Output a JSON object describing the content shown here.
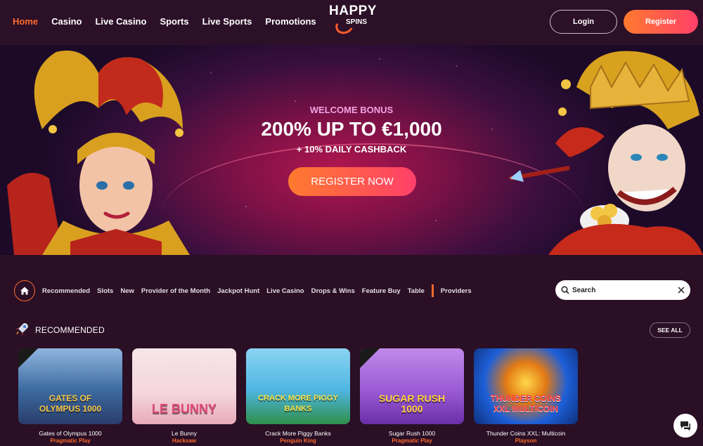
{
  "header": {
    "nav": [
      "Home",
      "Casino",
      "Live Casino",
      "Sports",
      "Live Sports",
      "Promotions"
    ],
    "logo_line1": "HAPPY",
    "logo_line2": "SPINS",
    "login": "Login",
    "register": "Register"
  },
  "hero": {
    "welcome": "WELCOME BONUS",
    "headline": "200% UP TO €1,000",
    "cashback": "+ 10% DAILY CASHBACK",
    "cta": "REGISTER NOW"
  },
  "categories": [
    "Recommended",
    "Slots",
    "New",
    "Provider of the Month",
    "Jackpot Hunt",
    "Live Casino",
    "Drops & Wins",
    "Feature Buy",
    "Table"
  ],
  "providers_label": "Providers",
  "search": {
    "placeholder": "Search"
  },
  "recommended": {
    "title": "RECOMMENDED",
    "see_all": "SEE ALL",
    "games": [
      {
        "name": "Gates of Olympus 1000",
        "provider": "Pragmatic Play",
        "art": "GATES OF OLYMPUS 1000",
        "badge": "DROPS & WINS",
        "bg": "#3c6aa0",
        "fg": "#f5c542"
      },
      {
        "name": "Le Bunny",
        "provider": "Hacksaw",
        "art": "LE BUNNY",
        "badge": "",
        "bg": "#f4d6dc",
        "fg": "#e14a7c"
      },
      {
        "name": "Crack More Piggy Banks",
        "provider": "Penguin King",
        "art": "CRACK MORE PIGGY BANKS",
        "badge": "",
        "bg": "#4fb6e3",
        "fg": "#f7e04a"
      },
      {
        "name": "Sugar Rush 1000",
        "provider": "Pragmatic Play",
        "art": "SUGAR RUSH 1000",
        "badge": "DROPS & WINS",
        "bg": "#9b5bd6",
        "fg": "#ffd13a"
      },
      {
        "name": "Thunder Coins XXL: Multicoin",
        "provider": "Playson",
        "art": "THUNDER COINS XXL MULTICOIN",
        "badge": "",
        "bg": "#1d5fd8",
        "fg": "#ff3b3b"
      }
    ]
  },
  "colors": {
    "accent": "#ff6a2d",
    "background": "#2a0f25",
    "cta_gradient_start": "#ff7a2e",
    "cta_gradient_end": "#ff3f6a"
  },
  "icons": [
    "home-icon",
    "rocket-icon",
    "search-icon",
    "close-icon",
    "chat-icon"
  ]
}
